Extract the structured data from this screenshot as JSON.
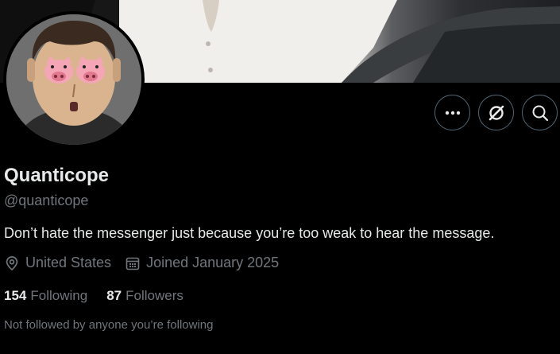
{
  "profile": {
    "display_name": "Quanticope",
    "handle": "@quanticope",
    "bio": "Don’t hate the messenger just because you’re too weak to hear the message.",
    "location": "United States",
    "joined": "Joined January 2025"
  },
  "stats": {
    "following_count": "154",
    "following_label": "Following",
    "followers_count": "87",
    "followers_label": "Followers"
  },
  "social_context": "Not followed by anyone you’re following",
  "icons": {
    "more": "more-icon",
    "grok": "grok-icon",
    "search": "search-icon",
    "location": "location-pin-icon",
    "calendar": "calendar-icon"
  },
  "colors": {
    "background": "#000000",
    "primary_text": "#e7e9ea",
    "secondary_text": "#71767b",
    "button_border": "#536471"
  }
}
